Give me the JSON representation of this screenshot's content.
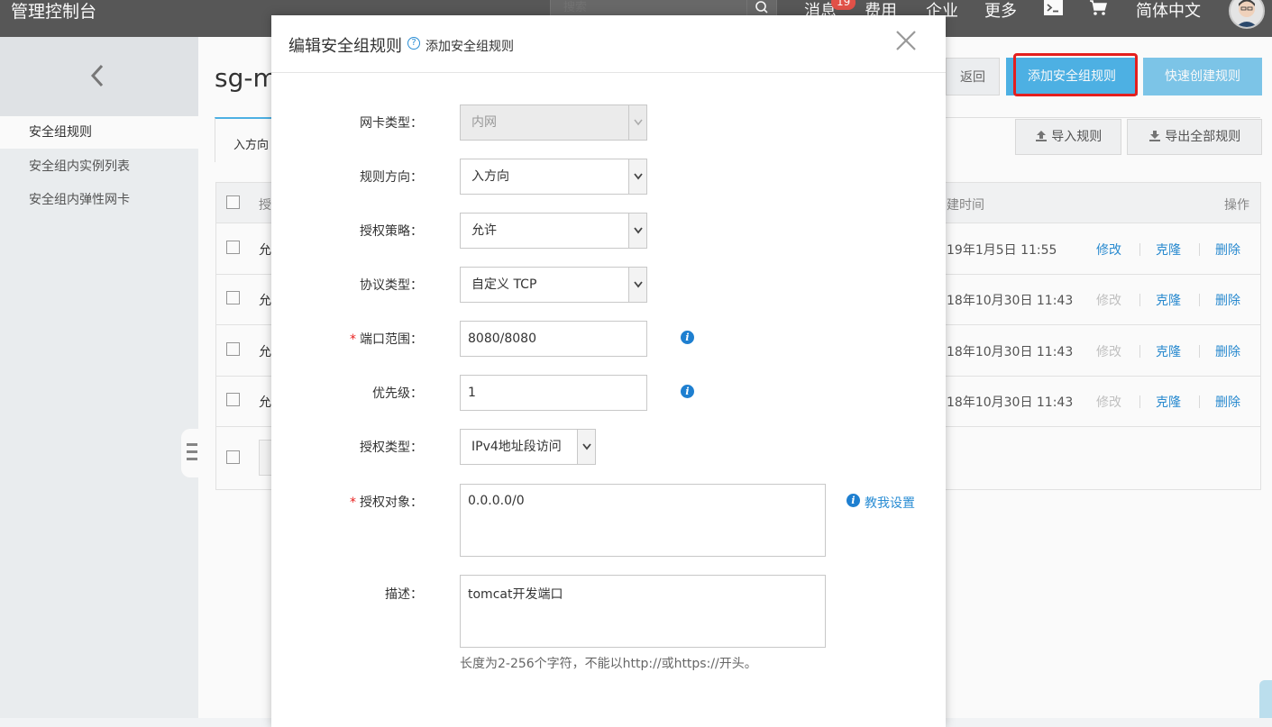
{
  "topbar": {
    "brand": "管理控制台",
    "search_placeholder": "搜索",
    "nav": {
      "messages": "消息",
      "messages_badge": "19",
      "billing": "费用",
      "enterprise": "企业",
      "more": "更多",
      "language": "简体中文"
    }
  },
  "sidebar": {
    "items": [
      {
        "label": "安全组规则",
        "active": true
      },
      {
        "label": "安全组内实例列表",
        "active": false
      },
      {
        "label": "安全组内弹性网卡",
        "active": false
      }
    ]
  },
  "main": {
    "title": "sg-m",
    "back_label": "返回",
    "add_rule_label": "添加安全组规则",
    "quick_create_label": "快速创建规则",
    "import_label": "导入规则",
    "export_label": "导出全部规则",
    "tab_inbound": "入方向",
    "table": {
      "header_auth": "授",
      "header_created": "建时间",
      "header_actions": "操作",
      "rows": [
        {
          "policy": "允",
          "created": "19年1月5日 11:55",
          "edit": "修改",
          "edit_enabled": true,
          "clone": "克隆",
          "delete": "删除"
        },
        {
          "policy": "允",
          "created": "18年10月30日 11:43",
          "edit": "修改",
          "edit_enabled": false,
          "clone": "克隆",
          "delete": "删除"
        },
        {
          "policy": "允",
          "created": "18年10月30日 11:43",
          "edit": "修改",
          "edit_enabled": false,
          "clone": "克隆",
          "delete": "删除"
        },
        {
          "policy": "允",
          "created": "18年10月30日 11:43",
          "edit": "修改",
          "edit_enabled": false,
          "clone": "克隆",
          "delete": "删除"
        }
      ]
    }
  },
  "modal": {
    "title": "编辑安全组规则",
    "help_link": "添加安全组规则",
    "fields": {
      "nic_type": {
        "label": "网卡类型：",
        "value": "内网"
      },
      "direction": {
        "label": "规则方向：",
        "value": "入方向"
      },
      "policy": {
        "label": "授权策略：",
        "value": "允许"
      },
      "protocol": {
        "label": "协议类型：",
        "value": "自定义 TCP"
      },
      "port_range": {
        "label": "端口范围：",
        "value": "8080/8080"
      },
      "priority": {
        "label": "优先级：",
        "value": "1"
      },
      "auth_type": {
        "label": "授权类型：",
        "value": "IPv4地址段访问"
      },
      "auth_object": {
        "label": "授权对象：",
        "value": "0.0.0.0/0",
        "teach": "教我设置"
      },
      "description": {
        "label": "描述：",
        "value": "tomcat开发端口",
        "hint": "长度为2-256个字符，不能以http://或https://开头。"
      }
    },
    "required_mark": "*",
    "info_glyph": "i"
  },
  "colors": {
    "accent": "#4fb4e8",
    "link": "#2a8dd4",
    "highlight": "#e9201f"
  }
}
